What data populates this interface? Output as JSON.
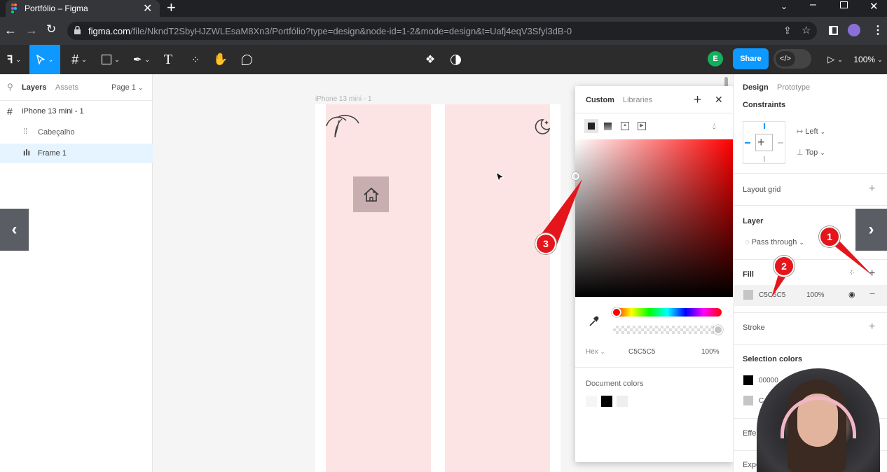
{
  "browser": {
    "tab_title": "Portfólio – Figma",
    "url_host": "figma.com",
    "url_path": "/file/NkndT2SbyHJZWLEsaM8Xn3/Portfólio?type=design&node-id=1-2&mode=design&t=Uafj4eqV3Sfyl3dB-0"
  },
  "toolbar": {
    "avatar_letter": "E",
    "share_label": "Share",
    "zoom": "100%"
  },
  "left_panel": {
    "tabs": {
      "layers": "Layers",
      "assets": "Assets",
      "page": "Page 1"
    },
    "layers": [
      {
        "name": "iPhone 13 mini - 1"
      },
      {
        "name": "Cabeçalho"
      },
      {
        "name": "Frame 1"
      }
    ]
  },
  "canvas": {
    "frame_label": "iPhone 13 mini - 1",
    "frame_color": "#fde4e4"
  },
  "color_picker": {
    "tabs": {
      "custom": "Custom",
      "libraries": "Libraries"
    },
    "format": "Hex",
    "hex": "C5C5C5",
    "opacity": "100%",
    "document_colors_label": "Document colors",
    "document_colors": [
      "#f5f5f5",
      "#000000",
      "#eeeeee"
    ]
  },
  "design_panel": {
    "tabs": {
      "design": "Design",
      "prototype": "Prototype"
    },
    "constraints_label": "Constraints",
    "constraint_h": "Left",
    "constraint_v": "Top",
    "layout_grid_label": "Layout grid",
    "layer_label": "Layer",
    "blend_mode": "Pass through",
    "fill_label": "Fill",
    "fill_hex": "C5C5C5",
    "fill_opacity": "100%",
    "stroke_label": "Stroke",
    "selection_colors_label": "Selection colors",
    "selection_colors": [
      {
        "hex": "00000",
        "color": "#000000"
      },
      {
        "hex": "C",
        "color": "#c5c5c5"
      }
    ],
    "effects_label": "Effe",
    "export_label": "Export"
  },
  "annotations": {
    "one": "1",
    "two": "2",
    "three": "3"
  },
  "colors": {
    "accent_blue": "#0d99ff",
    "annotation_red": "#e4161c",
    "avatar_green": "#14ae5c"
  }
}
